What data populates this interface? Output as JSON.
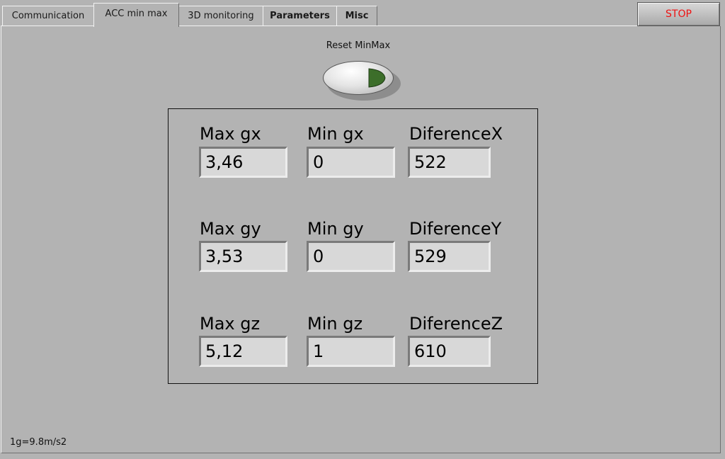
{
  "tabs": [
    {
      "label": "Communication"
    },
    {
      "label": "ACC min max"
    },
    {
      "label": "3D monitoring"
    },
    {
      "label": "Parameters"
    },
    {
      "label": "Misc"
    }
  ],
  "stop_label": "STOP",
  "reset": {
    "label": "Reset MinMax",
    "light_color": "#3c6e2a"
  },
  "rows": [
    {
      "max_label": "Max gx",
      "max_value": "3,46",
      "min_label": "Min gx",
      "min_value": "0",
      "diff_label": "DiferenceX",
      "diff_value": "522"
    },
    {
      "max_label": "Max gy",
      "max_value": "3,53",
      "min_label": "Min gy",
      "min_value": "0",
      "diff_label": "DiferenceY",
      "diff_value": "529"
    },
    {
      "max_label": "Max gz",
      "max_value": "5,12",
      "min_label": "Min gz",
      "min_value": "1",
      "diff_label": "DiferenceZ",
      "diff_value": "610"
    }
  ],
  "footer_note": "1g=9.8m/s2"
}
